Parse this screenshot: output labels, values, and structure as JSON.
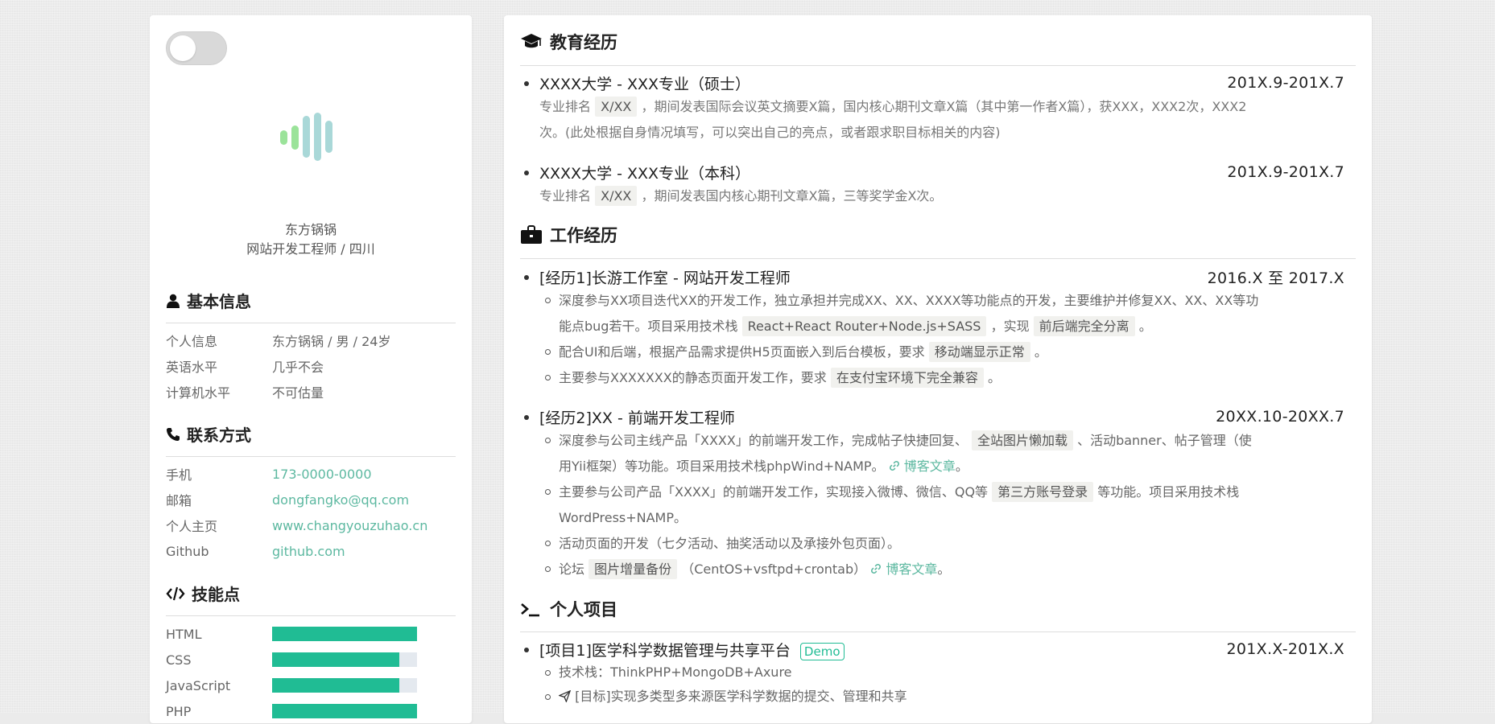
{
  "colors": {
    "accent": "#20bc94",
    "link": "#5cb8a0",
    "bar_bg": "#e4e9ef"
  },
  "profile": {
    "name": "东方锅锅",
    "role": "网站开发工程师 / 四川"
  },
  "basic": {
    "title": "基本信息",
    "rows": [
      {
        "k": "个人信息",
        "v": "东方锅锅 / 男 / 24岁"
      },
      {
        "k": "英语水平",
        "v": "几乎不会"
      },
      {
        "k": "计算机水平",
        "v": "不可估量"
      }
    ]
  },
  "contact": {
    "title": "联系方式",
    "rows": [
      {
        "k": "手机",
        "v": "173-0000-0000"
      },
      {
        "k": "邮箱",
        "v": "dongfangko@qq.com"
      },
      {
        "k": "个人主页",
        "v": "www.changyouzuhao.cn"
      },
      {
        "k": "Github",
        "v": "github.com"
      }
    ]
  },
  "skills": {
    "title": "技能点",
    "items": [
      {
        "name": "HTML",
        "level": 1.0
      },
      {
        "name": "CSS",
        "level": 0.88
      },
      {
        "name": "JavaScript",
        "level": 0.88
      },
      {
        "name": "PHP",
        "level": 1.0
      }
    ]
  },
  "education": {
    "title": "教育经历",
    "items": [
      {
        "title": "XXXX大学 - XXX专业（硕士）",
        "date": "201X.9-201X.7",
        "d1": "专业排名",
        "code": "X/XX",
        "d2": "，期间发表国际会议英文摘要X篇，国内核心期刊文章X篇（其中第一作者X篇），获XXX，XXX2次，XXX2",
        "d3": "次。(此处根据自身情况填写，可以突出自己的亮点，或者跟求职目标相关的内容)"
      },
      {
        "title": "XXXX大学 - XXX专业（本科）",
        "date": "201X.9-201X.7",
        "d1": "专业排名",
        "code": "X/XX",
        "d2": "，期间发表国内核心期刊文章X篇，三等奖学金X次。"
      }
    ]
  },
  "work": {
    "title": "工作经历",
    "job1": {
      "title": "[经历1]长游工作室 - 网站开发工程师",
      "date": "2016.X 至 2017.X",
      "l1a": "深度参与XX项目迭代XX的开发工作，独立承担并完成XX、XX、XXXX等功能点的开发，主要维护并修复XX、XX、XX等功",
      "l1b": "能点bug若干。项目采用技术栈",
      "l1c": "React+React Router+Node.js+SASS",
      "l1d": "，实现",
      "l1e": "前后端完全分离",
      "l1f": "。",
      "l2a": "配合UI和后端，根据产品需求提供H5页面嵌入到后台模板，要求",
      "l2b": "移动端显示正常",
      "l2c": "。",
      "l3a": "主要参与XXXXXXX的静态页面开发工作，要求",
      "l3b": "在支付宝环境下完全兼容",
      "l3c": "。"
    },
    "job2": {
      "title": "[经历2]XX - 前端开发工程师",
      "date": "20XX.10-20XX.7",
      "l1a": "深度参与公司主线产品「XXXX」的前端开发工作，完成帖子快捷回复、",
      "l1b": "全站图片懒加载",
      "l1c": "、活动banner、帖子管理（使",
      "l1d": "用Yii框架）等功能。项目采用技术栈phpWind+NAMP。",
      "blog": "博客文章",
      "period": "。",
      "l2a": "主要参与公司产品「XXXX」的前端开发工作，实现接入微博、微信、QQ等",
      "l2b": "第三方账号登录",
      "l2c": "等功能。项目采用技术栈",
      "l2d": "WordPress+NAMP。",
      "l3": "活动页面的开发（七夕活动、抽奖活动以及承接外包页面）。",
      "l4a": "论坛",
      "l4b": "图片增量备份",
      "l4c": "（CentOS+vsftpd+crontab）"
    }
  },
  "projects": {
    "title": "个人项目",
    "p1": {
      "title": "[项目1]医学科学数据管理与共享平台",
      "demo": "Demo",
      "date": "201X.X-201X.X",
      "stack": "技术栈：ThinkPHP+MongoDB+Axure",
      "goal": "[目标]实现多类型多来源医学科学数据的提交、管理和共享"
    }
  }
}
